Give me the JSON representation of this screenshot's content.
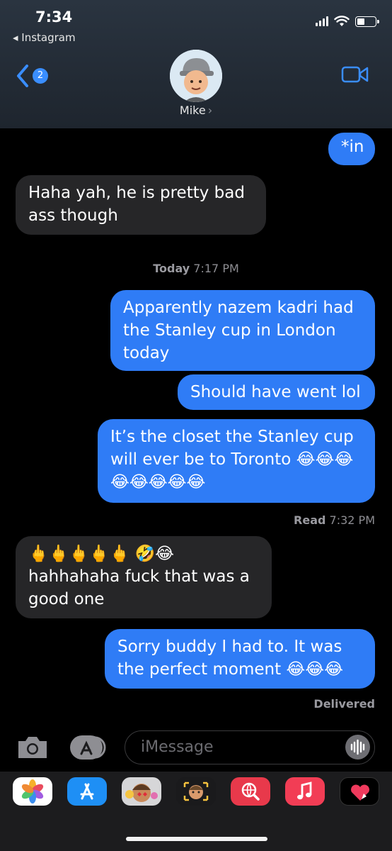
{
  "status_bar": {
    "time": "7:34",
    "back_app": "◂ Instagram"
  },
  "header": {
    "unread_count": "2",
    "contact_name": "Mike",
    "chevron": "›"
  },
  "messages": [
    {
      "from": "me",
      "text": "*in"
    },
    {
      "from": "them",
      "text": "Haha yah, he is pretty bad ass though"
    },
    {
      "type": "timestamp",
      "label": "Today",
      "time": "7:17 PM"
    },
    {
      "from": "me",
      "text": "Apparently nazem kadri had the Stanley cup in London today"
    },
    {
      "from": "me",
      "text": "Should have went lol"
    },
    {
      "from": "me",
      "text": "It’s the closet the Stanley cup will ever be to Toronto 😂😂😂😂😂😂😂😂"
    },
    {
      "type": "receipt",
      "label": "Read",
      "time": "7:32 PM"
    },
    {
      "from": "them",
      "text": "🖕🖕🖕🖕🖕 🤣😂 hahhahaha fuck that was a good one"
    },
    {
      "from": "me",
      "text": "Sorry buddy I had to. It was the perfect moment 😂😂😂"
    },
    {
      "type": "receipt",
      "label": "Delivered"
    }
  ],
  "input": {
    "placeholder": "iMessage"
  },
  "icons": {
    "back": "chevron-left-icon",
    "video": "video-camera-icon",
    "camera": "camera-icon",
    "appstore": "app-store-icon",
    "audio": "waveform-icon"
  },
  "colors": {
    "sent_bubble": "#2f7cf6",
    "received_bubble": "#262628",
    "accent": "#3a8eff"
  },
  "app_drawer": [
    {
      "name": "Photos"
    },
    {
      "name": "App Store"
    },
    {
      "name": "Memoji Stickers"
    },
    {
      "name": "Animoji"
    },
    {
      "name": "Images Search"
    },
    {
      "name": "Music"
    },
    {
      "name": "Digital Touch"
    }
  ]
}
